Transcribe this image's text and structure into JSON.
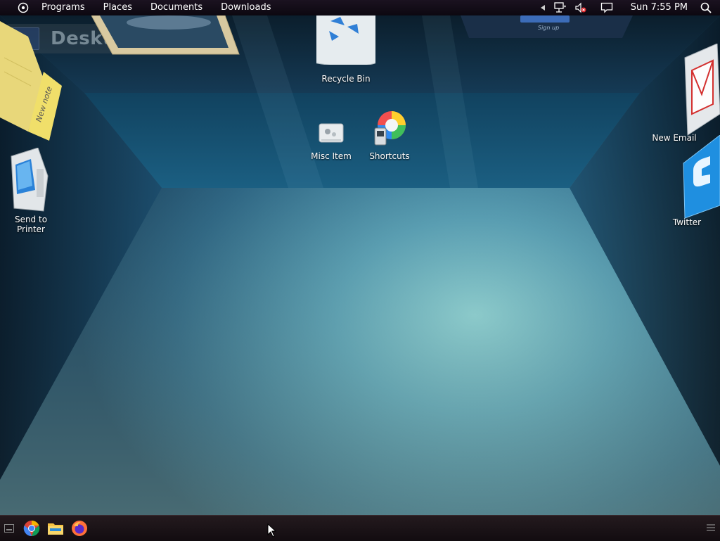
{
  "topbar": {
    "menu": [
      "Programs",
      "Places",
      "Documents",
      "Downloads"
    ],
    "clock": "Sun 7:55 PM"
  },
  "desktop": {
    "title": "Desktop",
    "icons": {
      "recycle_bin": "Recycle Bin",
      "misc_item": "Misc Item",
      "shortcuts": "Shortcuts",
      "send_to_printer_line1": "Send to",
      "send_to_printer_line2": "Printer",
      "new_email": "New Email",
      "twitter": "Twitter",
      "sticky_note": "New note",
      "signup": "Sign up"
    }
  },
  "taskbar": {
    "apps": [
      "show-desktop",
      "chrome",
      "file-manager",
      "firefox"
    ]
  },
  "colors": {
    "room_light": "#7fd0dc",
    "room_dark": "#0c2a3d",
    "topbar": "#150e18",
    "taskbar": "#1a1216"
  }
}
